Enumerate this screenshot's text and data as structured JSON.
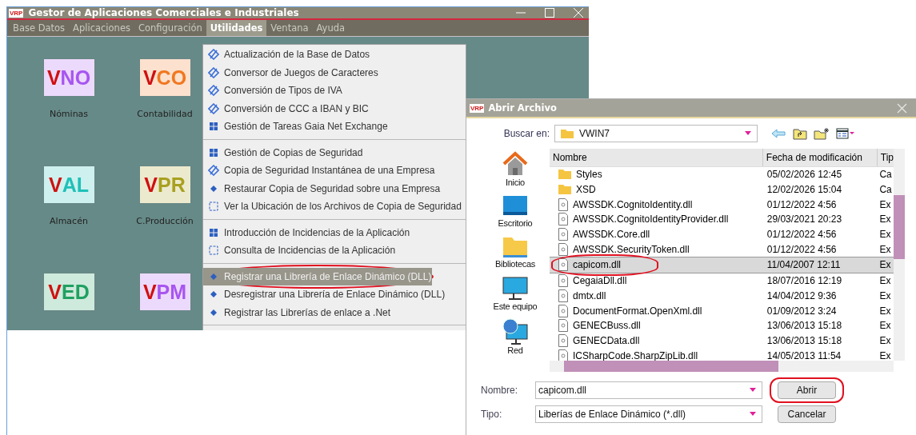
{
  "main_window": {
    "logo": "VRP",
    "title": "Gestor de Aplicaciones Comerciales e Industriales"
  },
  "menu_bar": [
    {
      "label": "Base Datos",
      "selected": false
    },
    {
      "label": "Aplicaciones",
      "selected": false
    },
    {
      "label": "Configuración",
      "selected": false
    },
    {
      "label": "Utilidades",
      "selected": true
    },
    {
      "label": "Ventana",
      "selected": false
    },
    {
      "label": "Ayuda",
      "selected": false
    }
  ],
  "menu_groups": [
    [
      {
        "kind": "edit",
        "label": "Actualización de la Base de Datos",
        "selected": false,
        "circled": false
      },
      {
        "kind": "edit",
        "label": "Conversor de Juegos de Caracteres",
        "selected": false,
        "circled": false
      },
      {
        "kind": "edit",
        "label": "Conversión de Tipos de IVA",
        "selected": false,
        "circled": false
      },
      {
        "kind": "edit",
        "label": "Conversión de CCC a IBAN y BIC",
        "selected": false,
        "circled": false
      },
      {
        "kind": "grid",
        "label": "Gestión de Tareas Gaia Net Exchange",
        "selected": false,
        "circled": false
      }
    ],
    [
      {
        "kind": "grid",
        "label": "Gestión de Copias de Seguridad",
        "selected": false,
        "circled": false
      },
      {
        "kind": "edit",
        "label": "Copia de Seguridad Instantánea de una Empresa",
        "selected": false,
        "circled": false
      },
      {
        "kind": "bullet",
        "label": "Restaurar Copia de Seguridad sobre una Empresa",
        "selected": false,
        "circled": false
      },
      {
        "kind": "frame",
        "label": "Ver la Ubicación de los Archivos de Copia de Seguridad",
        "selected": false,
        "circled": false
      }
    ],
    [
      {
        "kind": "grid",
        "label": "Introducción de Incidencias de la Aplicación",
        "selected": false,
        "circled": false
      },
      {
        "kind": "frame",
        "label": "Consulta de Incidencias de la Aplicación",
        "selected": false,
        "circled": false
      }
    ],
    [
      {
        "kind": "bullet",
        "label": "Registrar una Librería de Enlace Dinámico (DLL)",
        "selected": true,
        "circled": true
      },
      {
        "kind": "bullet",
        "label": "Desregistrar una Librería de Enlace Dinámico (DLL)",
        "selected": false,
        "circled": false
      },
      {
        "kind": "bullet",
        "label": "Registrar las Librerías de enlace a .Net",
        "selected": false,
        "circled": false
      }
    ]
  ],
  "apps": [
    {
      "prefix": "V",
      "suffix": "NO",
      "label": "Nóminas",
      "color": "#a855f0"
    },
    {
      "prefix": "V",
      "suffix": "CO",
      "label": "Contabilidad",
      "color": "#f07820"
    },
    {
      "prefix": "V",
      "suffix": "AL",
      "label": "Almacén",
      "color": "#20c0b8"
    },
    {
      "prefix": "V",
      "suffix": "PR",
      "label": "C.Producción",
      "color": "#a8a020"
    },
    {
      "prefix": "V",
      "suffix": "ED",
      "color": "#20a060"
    },
    {
      "prefix": "V",
      "suffix": "PM",
      "color": "#a855f0"
    }
  ],
  "dialog": {
    "logo": "VRP",
    "title": "Abrir Archivo",
    "look_in_label": "Buscar en:",
    "look_in_value": "VWIN7",
    "places": [
      {
        "kind": "home",
        "label": "Inicio"
      },
      {
        "kind": "desktop",
        "label": "Escritorio"
      },
      {
        "kind": "folder",
        "label": "Bibliotecas"
      },
      {
        "kind": "computer",
        "label": "Este equipo"
      },
      {
        "kind": "network",
        "label": "Red"
      }
    ],
    "columns": [
      "Nombre",
      "Fecha de modificación",
      "Tip"
    ],
    "files": [
      {
        "kind": "folder",
        "name": "Styles",
        "date": "05/02/2026 12:45",
        "type": "Ca",
        "selected": false,
        "circled": false
      },
      {
        "kind": "folder",
        "name": "XSD",
        "date": "12/02/2026 15:04",
        "type": "Ca",
        "selected": false,
        "circled": false
      },
      {
        "kind": "file",
        "name": "AWSSDK.CognitoIdentity.dll",
        "date": "01/12/2022 4:56",
        "type": "Ex",
        "selected": false,
        "circled": false
      },
      {
        "kind": "file",
        "name": "AWSSDK.CognitoIdentityProvider.dll",
        "date": "29/03/2021 20:23",
        "type": "Ex",
        "selected": false,
        "circled": false
      },
      {
        "kind": "file",
        "name": "AWSSDK.Core.dll",
        "date": "01/12/2022 4:56",
        "type": "Ex",
        "selected": false,
        "circled": false
      },
      {
        "kind": "file",
        "name": "AWSSDK.SecurityToken.dll",
        "date": "01/12/2022 4:56",
        "type": "Ex",
        "selected": false,
        "circled": false
      },
      {
        "kind": "file",
        "name": "capicom.dll",
        "date": "11/04/2007 12:11",
        "type": "Ex",
        "selected": true,
        "circled": true
      },
      {
        "kind": "file",
        "name": "CegaiaDll.dll",
        "date": "18/07/2016 12:19",
        "type": "Ex",
        "selected": false,
        "circled": false
      },
      {
        "kind": "file",
        "name": "dmtx.dll",
        "date": "14/04/2012 9:36",
        "type": "Ex",
        "selected": false,
        "circled": false
      },
      {
        "kind": "file",
        "name": "DocumentFormat.OpenXml.dll",
        "date": "01/09/2012 3:24",
        "type": "Ex",
        "selected": false,
        "circled": false
      },
      {
        "kind": "file",
        "name": "GENECBuss.dll",
        "date": "13/06/2013 15:18",
        "type": "Ex",
        "selected": false,
        "circled": false
      },
      {
        "kind": "file",
        "name": "GENECData.dll",
        "date": "13/06/2013 15:18",
        "type": "Ex",
        "selected": false,
        "circled": false
      },
      {
        "kind": "file",
        "name": "ICSharpCode.SharpZipLib.dll",
        "date": "14/05/2013 11:54",
        "type": "Ex",
        "selected": false,
        "circled": false
      }
    ],
    "name_label": "Nombre:",
    "name_value": "capicom.dll",
    "type_label": "Tipo:",
    "type_value": "Liberías de Enlace Dinámico (*.dll)",
    "buttons": [
      {
        "label": "Abrir",
        "circled": true
      },
      {
        "label": "Cancelar",
        "circled": false
      }
    ]
  }
}
